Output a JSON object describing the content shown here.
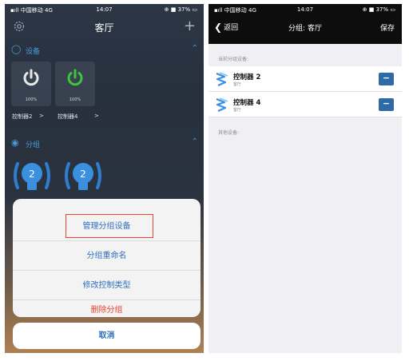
{
  "left": {
    "status": {
      "carrier": "▪ıll 中国移动 4G",
      "time": "14:07",
      "battery": "⊕ ■ 37% ▭"
    },
    "header": {
      "title": "客厅",
      "add": "+"
    },
    "devices_section": {
      "label": "设备",
      "icon": "bulb-outline-icon"
    },
    "devices": [
      {
        "label": "控制器2",
        "percent": "100%",
        "state": "off",
        "color": "#e8e8e8"
      },
      {
        "label": "控制器4",
        "percent": "100%",
        "state": "on",
        "color": "#3fc43f"
      }
    ],
    "chevron": ">",
    "groups_section": {
      "label": "分组",
      "icon": "network-icon"
    },
    "group_badges": [
      "2",
      "2"
    ],
    "action_sheet": {
      "items": [
        "管理分组设备",
        "分组重命名",
        "修改控制类型",
        "删除分组"
      ],
      "cancel": "取消"
    }
  },
  "right": {
    "status": {
      "carrier": "▪ıll 中国移动 4G",
      "time": "14:07",
      "battery": "⊕ ■ 37% ▭"
    },
    "header": {
      "back": "返回",
      "title": "分组: 客厅",
      "save": "保存"
    },
    "current_caption": "当前分组设备:",
    "current_devices": [
      {
        "name": "控制器 2",
        "room": "客厅"
      },
      {
        "name": "控制器 4",
        "room": "客厅"
      }
    ],
    "other_caption": "其他设备:",
    "remove_glyph": "−"
  },
  "colors": {
    "accent": "#2f6fbf",
    "danger": "#e8432e",
    "on": "#3fc43f",
    "caption_blue": "#4a9ad8"
  }
}
